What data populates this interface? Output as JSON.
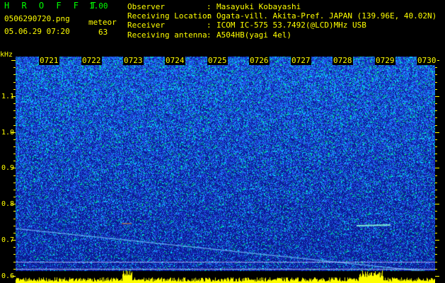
{
  "header": {
    "app_title": "H R O F F T",
    "app_version": "1.00",
    "file_name": "0506290720.png",
    "datetime": "05.06.29 07:20",
    "mode_label": "meteor",
    "mode_value": "63"
  },
  "metadata": [
    {
      "label": "Observer",
      "value": "Masayuki Kobayashi"
    },
    {
      "label": "Receiving Location",
      "value": "Ogata-vill. Akita-Pref. JAPAN (139.96E, 40.02N)"
    },
    {
      "label": "Receiver",
      "value": "ICOM IC-575 53.7492(@LCD)MHz USB"
    },
    {
      "label": "Receiving antenna",
      "value": "A504HB(yagi 4el)"
    }
  ],
  "spectrogram": {
    "time_labels": [
      "0721",
      "0722",
      "0723",
      "0724",
      "0725",
      "0726",
      "0727",
      "0728",
      "0729",
      "0730"
    ],
    "freq_unit": "kHz",
    "freq_labels": [
      "1.1",
      "1.0",
      "0.9",
      "0.8",
      "0.7",
      "0.6"
    ],
    "freq_range_khz": [
      0.58,
      1.21
    ],
    "minute_range": [
      20.0,
      30.0
    ],
    "colors": {
      "background": "#0a1a90",
      "noise_low": "#1c3cd8",
      "noise_mid": "#2f6cff",
      "noise_high": "#00e0ff",
      "signal": "#00ff60",
      "text": "#ffff00"
    }
  }
}
